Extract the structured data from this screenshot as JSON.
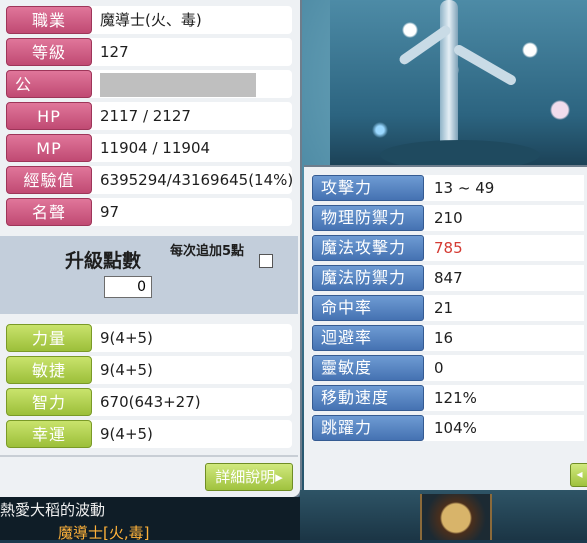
{
  "left_panel": {
    "rows": [
      {
        "label": "職業",
        "value": "魔導士(火、毒)"
      },
      {
        "label": "等級",
        "value": "127"
      },
      {
        "label": "公",
        "value": ""
      },
      {
        "label": "HP",
        "value": "2117 / 2127"
      },
      {
        "label": "MP",
        "value": "11904 / 11904"
      },
      {
        "label": "經驗值",
        "value": "6395294/43169645(14%)"
      },
      {
        "label": "名聲",
        "value": "97"
      }
    ],
    "upgrade": {
      "label": "升級點數",
      "points": "0",
      "each_add": "每次追加5點"
    },
    "stats": [
      {
        "label": "力量",
        "value": "9(4+5)"
      },
      {
        "label": "敏捷",
        "value": "9(4+5)"
      },
      {
        "label": "智力",
        "value": "670(643+27)"
      },
      {
        "label": "幸運",
        "value": "9(4+5)"
      }
    ],
    "detail_button": "詳細說明"
  },
  "right_panel": {
    "rows": [
      {
        "label": "攻擊力",
        "value": "13 ~ 49"
      },
      {
        "label": "物理防禦力",
        "value": "210"
      },
      {
        "label": "魔法攻擊力",
        "value": "785"
      },
      {
        "label": "魔法防禦力",
        "value": "847"
      },
      {
        "label": "命中率",
        "value": "21"
      },
      {
        "label": "迴避率",
        "value": "16"
      },
      {
        "label": "靈敏度",
        "value": "0"
      },
      {
        "label": "移動速度",
        "value": "121%"
      },
      {
        "label": "跳躍力",
        "value": "104%"
      }
    ],
    "highlight_color": "#d43b33"
  },
  "chat": {
    "line1": "熱愛大稻的波動",
    "line2": "魔導士[火,毒]"
  },
  "colors": {
    "pink_label": "#c04a73",
    "green_label": "#9cbf3a",
    "blue_label": "#4572b2"
  }
}
